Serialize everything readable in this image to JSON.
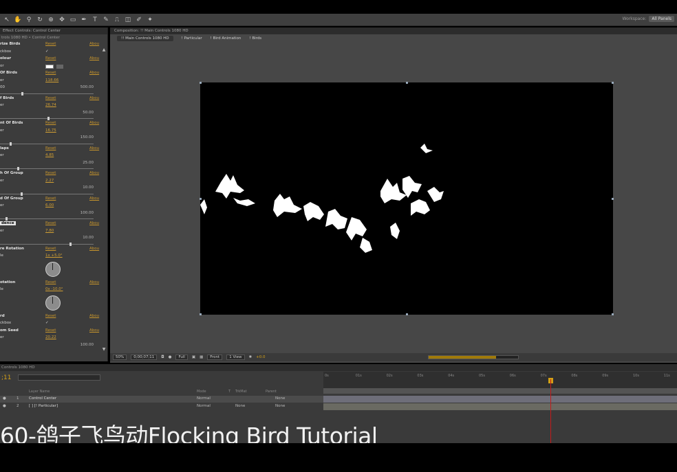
{
  "workspace": {
    "label": "Workspace:",
    "value": "All Panels"
  },
  "effects_panel": {
    "tab": "Effect Controls: Control Center",
    "crumb": "trols 1080 HD • Control Center",
    "reset": "Reset",
    "about": "Abou",
    "params": [
      {
        "name": "rize Birds",
        "sub": "ckbox"
      },
      {
        "name": "olour",
        "sub": "or"
      },
      {
        "name": "Of Birds",
        "sub": "er",
        "value": "118.66",
        "min": "00",
        "max": "500.00",
        "fraction": 0.24
      },
      {
        "name": "f Birds",
        "sub": "er",
        "value": "26.74",
        "max": "50.00",
        "fraction": 0.53
      },
      {
        "name": "nt Of Birds",
        "sub": "er",
        "value": "16.75",
        "max": "150.00",
        "fraction": 0.11
      },
      {
        "name": "laps",
        "sub": "er",
        "value": "4.85",
        "max": "25.00",
        "fraction": 0.19
      },
      {
        "name": "h Of Group",
        "sub": "er",
        "value": "2.27",
        "max": "10.00",
        "fraction": 0.23
      },
      {
        "name": "d Of Group",
        "sub": "er",
        "value": "6.00",
        "max": "100.00",
        "fraction": 0.06
      },
      {
        "name": "dence",
        "sub": "er",
        "value": "7.80",
        "max": "10.00",
        "fraction": 0.78,
        "highlight": true
      },
      {
        "name": "re Rotation",
        "sub": "le",
        "value": "1x +5.0°"
      },
      {
        "name": "otation",
        "sub": "le",
        "value": "0x -10.0°"
      },
      {
        "name": "rd",
        "sub": "ckbox"
      },
      {
        "name": "om Seed",
        "sub": "er",
        "value": "20.22",
        "max": "100.00"
      }
    ]
  },
  "composition": {
    "tab": "Composition: !! Main Controls 1080 HD",
    "crumbs": [
      "!! Main Controls 1080 HD",
      "! Particular",
      "! Bird Animation",
      "! Birds"
    ],
    "zoom": "50%",
    "timecode": "0;00;07;11",
    "resolution": "Full",
    "view": "Front",
    "views": "1 View",
    "exposure": "+0.0",
    "render_progress": 0.75
  },
  "timeline": {
    "tab": "Controls 1080 HD",
    "current_time": ";11",
    "columns": [
      "Layer Name",
      "Mode",
      "T",
      "TrkMat",
      "Parent"
    ],
    "ruler_ticks": [
      "0s",
      "01s",
      "02s",
      "03s",
      "04s",
      "05s",
      "06s",
      "07s",
      "08s",
      "09s",
      "10s",
      "11s"
    ],
    "layers": [
      {
        "num": "1",
        "name": "Control Center",
        "mode": "Normal",
        "trkmat": "",
        "parent": "None"
      },
      {
        "num": "2",
        "name": "[ ] [! Particular]",
        "mode": "Normal",
        "trkmat": "None",
        "parent": "None"
      }
    ]
  },
  "caption": "60-鸽子飞鸟动Flocking Bird Tutorial"
}
